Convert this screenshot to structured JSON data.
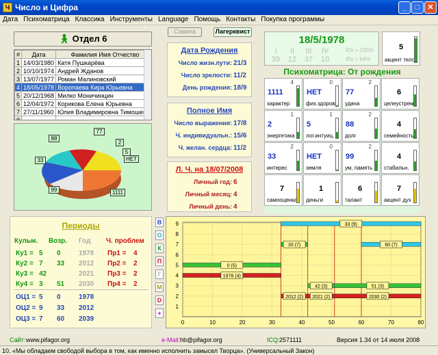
{
  "window": {
    "title": "Число и Цифра"
  },
  "menu": [
    "Дата",
    "Психоматрица",
    "Классика",
    "Инструменты",
    "Language",
    "Помощь",
    "Контакты",
    "Покупка программы"
  ],
  "toolbar": {
    "dept_label": "Отдел 6",
    "btn_savva": "Савина",
    "btn_lagerkvist": "Лагерквист"
  },
  "table": {
    "headers": [
      "#",
      "Дата",
      "Фамилия Имя Отчество"
    ],
    "rows": [
      [
        "1",
        "14/03/1980",
        "Катя Пушкарёва"
      ],
      [
        "2",
        "10/10/1974",
        "Андрей Жданов"
      ],
      [
        "3",
        "13/07/1977",
        "Роман Малиновский"
      ],
      [
        "4",
        "18/05/1978",
        "Воропаева Кира Юрьевна"
      ],
      [
        "5",
        "20/12/1968",
        "Милко Моничинцин"
      ],
      [
        "6",
        "12/04/1972",
        "Корикова Елена Юрьевна"
      ],
      [
        "7",
        "27/11/1960",
        "Юлия Владимировна Тимошенко"
      ],
      [
        "8",
        "",
        ""
      ]
    ]
  },
  "pie": {
    "labels": [
      "77",
      "2",
      "5",
      "НЕТ",
      "1111",
      "99",
      "33",
      "88"
    ]
  },
  "birth": {
    "title": "Дата Рождения",
    "rows": [
      [
        "Число жизн.пути:",
        "21/3"
      ],
      [
        "Число зрелости:",
        "11/2"
      ],
      [
        "День рождения:",
        "18/9"
      ]
    ]
  },
  "fullname": {
    "title": "Полное Имя",
    "rows": [
      [
        "Число выражения:",
        "17/8"
      ],
      [
        "Ч. индивидуальн.:",
        "15/6"
      ],
      [
        "Ч. желан. сердца:",
        "11/2"
      ]
    ]
  },
  "personal": {
    "title": "Л. Ч. на 18/07/2008",
    "rows": [
      [
        "Личный год:",
        "6"
      ],
      [
        "Личный месяц:",
        "4"
      ],
      [
        "Личный день:",
        "4"
      ]
    ]
  },
  "date_panel": {
    "date": "18/5/1978",
    "roman": [
      "I",
      "II",
      "III",
      "IV"
    ],
    "nums": [
      "39",
      "12",
      "37",
      "10"
    ],
    "ids1": "iDs = 235%",
    "ids2": "iBs = 64%"
  },
  "accent_body": {
    "value": "5",
    "label": "акцент тело"
  },
  "psy": {
    "title": "Психоматрица: От рождения",
    "cells": [
      {
        "v": "1111",
        "n": "4",
        "lbl": "характер",
        "fill": 0.9,
        "c": "g"
      },
      {
        "v": "НЕТ",
        "n": "0",
        "lbl": "физ.здоров.",
        "fill": 0.05,
        "c": "g"
      },
      {
        "v": "77",
        "n": "2",
        "lbl": "удача",
        "fill": 0.4,
        "c": "g"
      },
      {
        "v": "2",
        "n": "1",
        "lbl": "энергетика",
        "fill": 0.3,
        "c": "g"
      },
      {
        "v": "5",
        "n": "1",
        "lbl": "лог.интуиц.",
        "fill": 0.3,
        "c": "g"
      },
      {
        "v": "88",
        "n": "2",
        "lbl": "долг",
        "fill": 0.5,
        "c": "g"
      },
      {
        "v": "33",
        "n": "2",
        "lbl": "интерес",
        "fill": 0.5,
        "c": "g"
      },
      {
        "v": "НЕТ",
        "n": "0",
        "lbl": "земля",
        "fill": 0.05,
        "c": "g"
      },
      {
        "v": "99",
        "n": "2",
        "lbl": "ум, память",
        "fill": 0.5,
        "c": "g"
      }
    ],
    "right": [
      {
        "v": "6",
        "lbl": "целеустрем.",
        "fill": 0.6
      },
      {
        "v": "4",
        "lbl": "семейность",
        "fill": 0.45
      },
      {
        "v": "4",
        "lbl": "стабильн.",
        "fill": 0.45
      }
    ],
    "bottom": [
      {
        "v": "7",
        "lbl": "самооценка",
        "fill": 0.7
      },
      {
        "v": "1",
        "lbl": "деньги",
        "fill": 0.1
      },
      {
        "v": "6",
        "lbl": "талант",
        "fill": 0.6
      },
      {
        "v": "7",
        "lbl": "акцент дух",
        "fill": 0.7
      }
    ]
  },
  "periods": {
    "title": "Периоды",
    "headers": [
      "Кульм.",
      "Возр.",
      "Год",
      "Ч. проблем"
    ],
    "rows": [
      [
        "Ку1 =",
        "5",
        "0",
        "1978",
        "Пр1 =",
        "4"
      ],
      [
        "Ку2 =",
        "7",
        "33",
        "2012",
        "Пр2 =",
        "2"
      ],
      [
        "Ку3 =",
        "42",
        "",
        "2021",
        "Пр3 =",
        "2"
      ],
      [
        "Ку4 =",
        "3",
        "51",
        "2030",
        "Пр4 =",
        "2"
      ]
    ],
    "ots": [
      [
        "ОЦ1 =",
        "5",
        "0",
        "1978"
      ],
      [
        "ОЦ2 =",
        "9",
        "33",
        "2012"
      ],
      [
        "ОЦ3 =",
        "7",
        "60",
        "2039"
      ]
    ]
  },
  "side_buttons": [
    "В",
    "О",
    "К",
    "П",
    "Г",
    "М",
    "D",
    "+"
  ],
  "chart_data": {
    "type": "gantt",
    "xlim": [
      0,
      80
    ],
    "ylim": [
      0,
      9
    ],
    "xticks": [
      "0",
      "10",
      "20",
      "30",
      "40",
      "50",
      "60",
      "70",
      "80"
    ],
    "yticks": [
      "1",
      "2",
      "3",
      "4",
      "5",
      "6",
      "7",
      "8",
      "9"
    ],
    "bars": [
      {
        "label": "33 (9)",
        "x0": 33,
        "x1": 80,
        "y": 9,
        "color": "#2fc8e8"
      },
      {
        "label": "33 (7)",
        "x0": 33,
        "x1": 42,
        "y": 7,
        "color": "#36c236"
      },
      {
        "label": "60 (7)",
        "x0": 60,
        "x1": 80,
        "y": 7,
        "color": "#2fc8e8"
      },
      {
        "label": "0 (5)",
        "x0": 0,
        "x1": 33,
        "y": 5,
        "color": "#36c236"
      },
      {
        "label": "1978 (4)",
        "x0": 0,
        "x1": 33,
        "y": 4,
        "color": "#d42020"
      },
      {
        "label": "42 (3)",
        "x0": 42,
        "x1": 51,
        "y": 3,
        "color": "#36c236"
      },
      {
        "label": "51 (3)",
        "x0": 51,
        "x1": 80,
        "y": 3,
        "color": "#36c236"
      },
      {
        "label": "2012 (2)",
        "x0": 33,
        "x1": 42,
        "y": 2,
        "color": "#d42020"
      },
      {
        "label": "2021 (2)",
        "x0": 42,
        "x1": 51,
        "y": 2,
        "color": "#d42020"
      },
      {
        "label": "2030 (2)",
        "x0": 51,
        "x1": 80,
        "y": 2,
        "color": "#d42020"
      }
    ],
    "vlines": [
      33,
      42,
      51,
      60
    ]
  },
  "footer": {
    "site_label": "Сайт:",
    "site": "www.pifagor.org",
    "email_label": "e-Mail:",
    "email": "hb@pifagor.org",
    "icq_label": "ICQ:",
    "icq": "2571111",
    "version": "Версия 1.34 от 14 июля 2008",
    "quote": "10. «Мы обладаем свободой выбора в том, как именно исполнить замысел Творца». (Универсальный Закон)"
  }
}
